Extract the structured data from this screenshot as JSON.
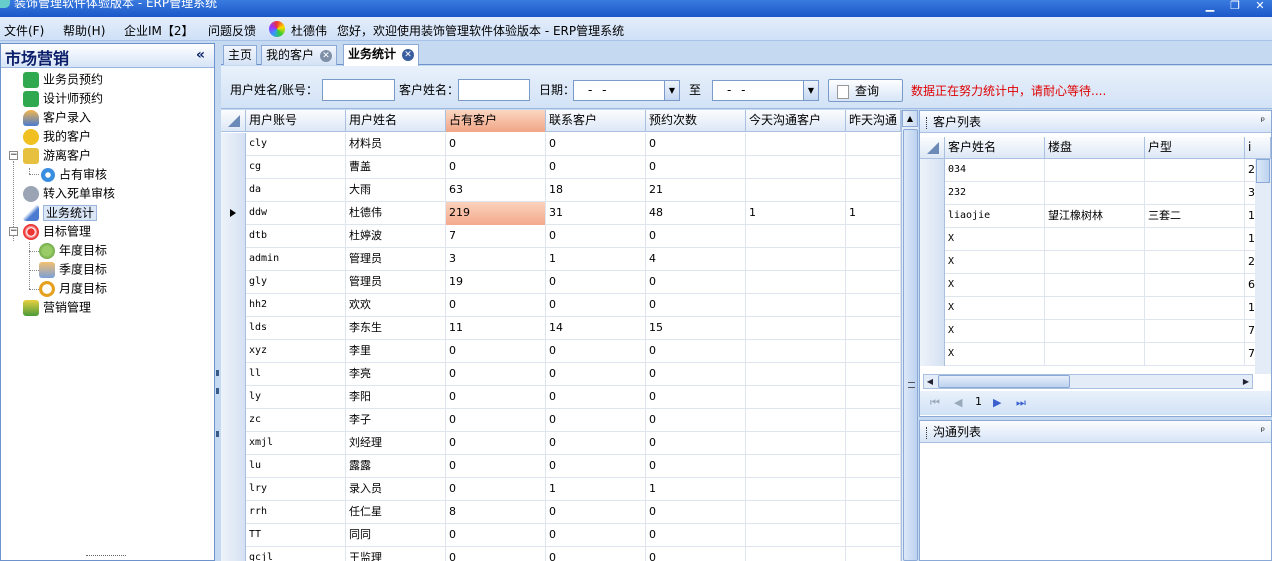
{
  "window": {
    "title": "装饰管理软件体验版本 - ERP管理系统",
    "minimize": "▁",
    "restore": "❐",
    "close": "✕"
  },
  "menubar": {
    "items": [
      "文件(F)",
      "帮助(H)",
      "企业IM【2】",
      "问题反馈"
    ],
    "user": "杜德伟",
    "welcome": "您好，欢迎使用装饰管理软件体验版本 - ERP管理系统"
  },
  "sidebar": {
    "title": "市场营销",
    "collapse": "«",
    "items": [
      {
        "label": "业务员预约",
        "icon": "phone-icon"
      },
      {
        "label": "设计师预约",
        "icon": "phone-icon"
      },
      {
        "label": "客户录入",
        "icon": "user-add-icon"
      },
      {
        "label": "我的客户",
        "icon": "smiley-icon"
      },
      {
        "label": "游离客户",
        "icon": "folder-icon"
      },
      {
        "label": "占有审核",
        "icon": "circle-icon"
      },
      {
        "label": "转入死单审核",
        "icon": "house-icon"
      },
      {
        "label": "业务统计",
        "icon": "chart-icon"
      },
      {
        "label": "目标管理",
        "icon": "target-icon"
      },
      {
        "label": "年度目标",
        "icon": "globe-icon"
      },
      {
        "label": "季度目标",
        "icon": "person-icon"
      },
      {
        "label": "月度目标",
        "icon": "clock-icon"
      },
      {
        "label": "营销管理",
        "icon": "basket-icon"
      }
    ]
  },
  "tabs": [
    {
      "label": "主页"
    },
    {
      "label": "我的客户"
    },
    {
      "label": "业务统计"
    }
  ],
  "query": {
    "user_label": "用户姓名/账号：",
    "customer_label": "客户姓名：",
    "date_label": "日期：",
    "to_label": "至",
    "date_from": "- -",
    "date_to": "- -",
    "search_label": "查询",
    "status": "数据正在努力统计中，请耐心等待...."
  },
  "main_table": {
    "columns": [
      "用户账号",
      "用户姓名",
      "占有客户",
      "联系客户",
      "预约次数",
      "今天沟通客户",
      "昨天沟通"
    ],
    "rows": [
      [
        "cly",
        "材料员",
        "0",
        "0",
        "0",
        "",
        ""
      ],
      [
        "cg",
        "曹盖",
        "0",
        "0",
        "0",
        "",
        ""
      ],
      [
        "da",
        "大雨",
        "63",
        "18",
        "21",
        "",
        ""
      ],
      [
        "ddw",
        "杜德伟",
        "219",
        "31",
        "48",
        "1",
        "1"
      ],
      [
        "dtb",
        "杜婷波",
        "7",
        "0",
        "0",
        "",
        ""
      ],
      [
        "admin",
        "管理员",
        "3",
        "1",
        "4",
        "",
        ""
      ],
      [
        "gly",
        "管理员",
        "19",
        "0",
        "0",
        "",
        ""
      ],
      [
        "hh2",
        "欢欢",
        "0",
        "0",
        "0",
        "",
        ""
      ],
      [
        "lds",
        "李东生",
        "11",
        "14",
        "15",
        "",
        ""
      ],
      [
        "xyz",
        "李里",
        "0",
        "0",
        "0",
        "",
        ""
      ],
      [
        "ll",
        "李亮",
        "0",
        "0",
        "0",
        "",
        ""
      ],
      [
        "ly",
        "李阳",
        "0",
        "0",
        "0",
        "",
        ""
      ],
      [
        "zc",
        "李子",
        "0",
        "0",
        "0",
        "",
        ""
      ],
      [
        "xmjl",
        "刘经理",
        "0",
        "0",
        "0",
        "",
        ""
      ],
      [
        "lu",
        "露露",
        "0",
        "0",
        "0",
        "",
        ""
      ],
      [
        "lry",
        "录入员",
        "0",
        "1",
        "1",
        "",
        ""
      ],
      [
        "rrh",
        "任仁星",
        "8",
        "0",
        "0",
        "",
        ""
      ],
      [
        "TT",
        "同同",
        "0",
        "0",
        "0",
        "",
        ""
      ],
      [
        "gcjl",
        "王监理",
        "0",
        "0",
        "0",
        "",
        ""
      ]
    ]
  },
  "customer_panel": {
    "title": "客户列表",
    "pin": "ᵖ",
    "columns": [
      "客户姓名",
      "楼盘",
      "户型",
      "i"
    ],
    "rows": [
      [
        "034",
        "",
        "",
        "2"
      ],
      [
        "232",
        "",
        "",
        "3"
      ],
      [
        "liaojie",
        "望江橡树林",
        "三套二",
        "1"
      ],
      [
        "X",
        "",
        "",
        "1"
      ],
      [
        "X",
        "",
        "",
        "2"
      ],
      [
        "X",
        "",
        "",
        "6"
      ],
      [
        "X",
        "",
        "",
        "1"
      ],
      [
        "X",
        "",
        "",
        "7"
      ],
      [
        "X",
        "",
        "",
        "7"
      ]
    ],
    "pager": {
      "first": "⏮",
      "prev": "◀",
      "page": "1",
      "next": "▶",
      "last": "⏭"
    }
  },
  "comm_panel": {
    "title": "沟通列表",
    "pin": "ᵖ"
  }
}
